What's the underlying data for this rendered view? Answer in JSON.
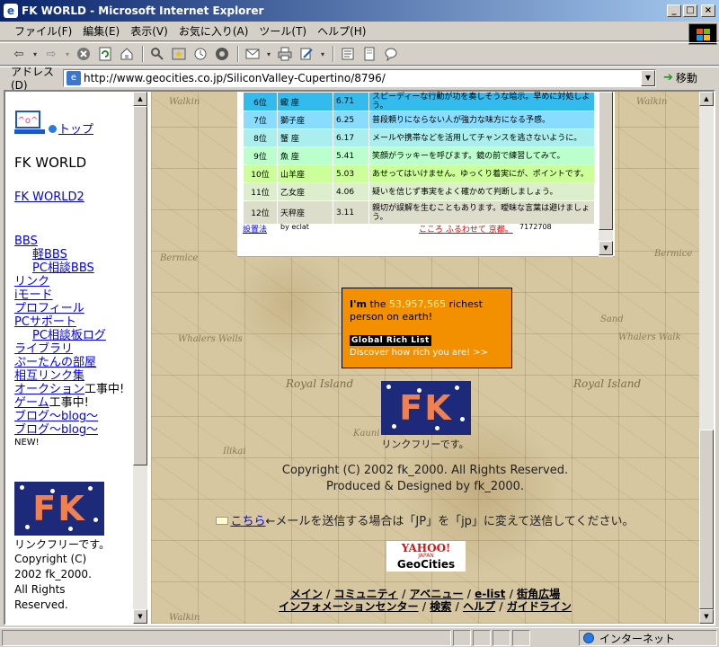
{
  "window": {
    "title": "FK WORLD - Microsoft Internet Explorer",
    "min": "_",
    "max": "□",
    "close": "×"
  },
  "menu": [
    "ファイル(F)",
    "編集(E)",
    "表示(V)",
    "お気に入り(A)",
    "ツール(T)",
    "ヘルプ(H)"
  ],
  "address": {
    "label": "アドレス(D)",
    "url": "http://www.geocities.co.jp/SiliconValley-Cupertino/8796/",
    "go": "移動"
  },
  "left": {
    "top_link": "トップ",
    "site_title": "FK WORLD",
    "world2_link": "FK WORLD2",
    "nav": [
      {
        "text": "BBS",
        "indent": false,
        "suffix": ""
      },
      {
        "text": "軽BBS",
        "indent": true,
        "suffix": ""
      },
      {
        "text": "PC相談BBS",
        "indent": true,
        "suffix": ""
      },
      {
        "text": "リンク",
        "indent": false,
        "suffix": ""
      },
      {
        "text": "iモード",
        "indent": false,
        "suffix": ""
      },
      {
        "text": "プロフィール",
        "indent": false,
        "suffix": ""
      },
      {
        "text": "PCサポート",
        "indent": false,
        "suffix": ""
      },
      {
        "text": "PC相談板ログ",
        "indent": true,
        "suffix": ""
      },
      {
        "text": "ライブラリ",
        "indent": false,
        "suffix": ""
      },
      {
        "text": "ぷーたんの部屋",
        "indent": false,
        "suffix": ""
      },
      {
        "text": "相互リンク集",
        "indent": false,
        "suffix": ""
      },
      {
        "text": "オークション",
        "indent": false,
        "suffix": "工事中!"
      },
      {
        "text": "ゲーム",
        "indent": false,
        "suffix": "工事中!"
      },
      {
        "text": "ブログ～blog～",
        "indent": false,
        "suffix": ""
      },
      {
        "text": "ブログ～blog～",
        "indent": false,
        "suffix": ""
      }
    ],
    "new_label": "NEW!",
    "logo_text": "FK",
    "link_free": "リンクフリーです。",
    "copy_lines": [
      "Copyright (C)",
      "2002 fk_2000.",
      "All Rights",
      "Reserved."
    ]
  },
  "ranking": [
    {
      "rank": "6位",
      "sign": "蠍 座",
      "score": "6.71",
      "msg": "スピーディーな行動が功を奏しそうな暗示。早めに対処しよう。",
      "color": "#33bbee"
    },
    {
      "rank": "7位",
      "sign": "獅子座",
      "score": "6.25",
      "msg": "普段頼りにならない人が強力な味方になる予感。",
      "color": "#88ddff"
    },
    {
      "rank": "8位",
      "sign": "蟹 座",
      "score": "6.17",
      "msg": "メールや携帯などを活用してチャンスを逃さないように。",
      "color": "#aaeeee"
    },
    {
      "rank": "9位",
      "sign": "魚 座",
      "score": "5.41",
      "msg": "笑顔がラッキーを呼びます。鏡の前で練習してみて。",
      "color": "#bbffcc"
    },
    {
      "rank": "10位",
      "sign": "山羊座",
      "score": "5.03",
      "msg": "あせってはいけません。ゆっくり着実にが、ポイントです。",
      "color": "#ccff99"
    },
    {
      "rank": "11位",
      "sign": "乙女座",
      "score": "4.06",
      "msg": "疑いを信じず事実をよく確かめて判断しましょう。",
      "color": "#ddeecc"
    },
    {
      "rank": "12位",
      "sign": "天秤座",
      "score": "3.11",
      "msg": "親切が誤解を生むこともあります。曖昧な言葉は避けましょう。",
      "color": "#ddddcc"
    }
  ],
  "rank_footer": {
    "install": "設置法",
    "by": "by eclat",
    "promo": "こころ ふるわせて 京都。",
    "count": "7172708"
  },
  "rich": {
    "im": "I'm",
    "the": "the",
    "number": "53,957,565",
    "tail": "richest",
    "line2": "person on earth!",
    "badge": "Global Rich List",
    "discover": "Discover how rich you are! >>"
  },
  "center": {
    "logo_text": "FK",
    "link_free": "リンクフリーです。",
    "copyright": "Copyright (C) 2002 fk_2000. All Rights Reserved.",
    "produced": "Produced & Designed by fk_2000.",
    "mail_link": "こちら",
    "mail_note": "←メールを送信する場合は「JP」を「jp」に変えて送信してください。",
    "yahoo": "YAHOO!",
    "japan": "JAPAN",
    "geocities": "GeoCities",
    "links_row1": [
      "メイン",
      "コミュニティ",
      "アベニュー",
      "e-list",
      "街角広場"
    ],
    "links_row2": [
      "インフォメーションセンター",
      "検索",
      "ヘルプ",
      "ガイドライン"
    ],
    "sep": "/"
  },
  "map_labels": [
    "Walkin",
    "Bermice",
    "Whalers Wells",
    "Royal Island",
    "Kauni",
    "Ilikai",
    "Sand",
    "Whalers Walk"
  ],
  "status": {
    "zone": "インターネット"
  }
}
